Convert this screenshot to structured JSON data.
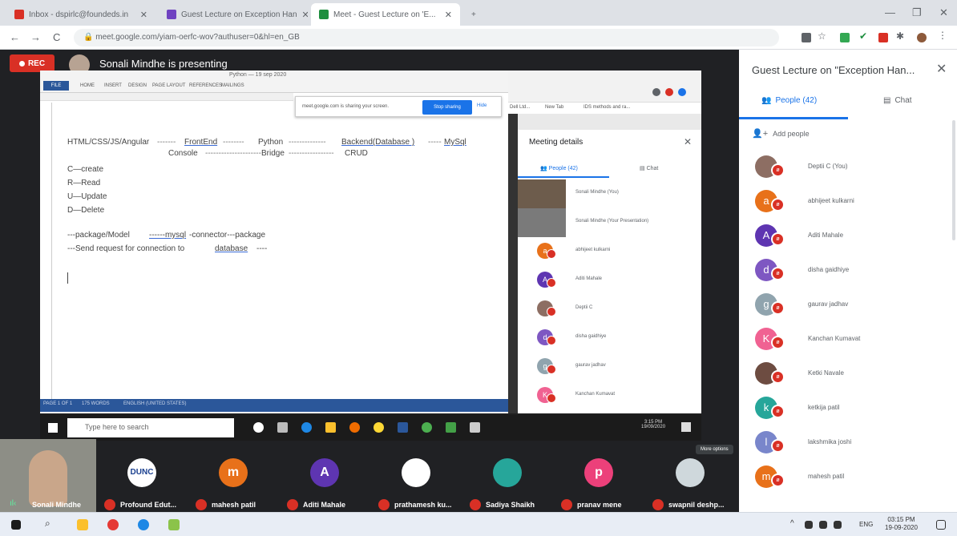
{
  "browser": {
    "tabs": [
      {
        "label": "Inbox - dspirlc@foundeds.in",
        "color": "#d93025",
        "active": false
      },
      {
        "label": "Guest Lecture on Exception Han",
        "color": "#6f42c1",
        "active": false
      },
      {
        "label": "Meet - Guest Lecture on 'E...",
        "color": "#1e8e3e",
        "active": true
      }
    ],
    "new_tab": "+",
    "minimize": "—",
    "maximize": "❐",
    "close": "✕",
    "url": "meet.google.com/yiam-oerfc-wov?authuser=0&hl=en_GB",
    "back": "←",
    "forward": "→",
    "reload": "C"
  },
  "meet": {
    "rec_label": "REC",
    "presenting_text": "Sonali Mindhe is presenting",
    "tooltip": "More options",
    "accent": "#1a73e8",
    "danger": "#d93025"
  },
  "word": {
    "title": "Python — 19 sep 2020",
    "file_tab": "FILE",
    "ribbon_tabs": [
      "HOME",
      "INSERT",
      "DESIGN",
      "PAGE LAYOUT",
      "REFERENCES",
      "MAILINGS"
    ],
    "lines": {
      "l1a": "HTML/CSS/JS/Angular",
      "l1b": "FrontEnd",
      "l1c": "Python",
      "l1d": "Backend(Database )",
      "l1e": "MySql",
      "l1f": "----",
      "l2a": "Console",
      "l2b": "Bridge",
      "l2c": "CRUD",
      "c": "C—create",
      "r": "R—Read",
      "u": "U—Update",
      "d": "D—Delete",
      "pkg1": "---package/Model",
      "pkg2": "------mysql",
      "pkg3": "-connector---package",
      "send1": "---Send request for connection to",
      "send2": "database",
      "send3": "----"
    },
    "status": [
      "PAGE 1 OF 1",
      "175 WORDS",
      "ENGLISH (UNITED STATES)"
    ]
  },
  "sharing_bar": {
    "text": "meet.google.com is sharing your screen.",
    "stop": "Stop sharing",
    "hide": "Hide"
  },
  "inner_browser": {
    "bookmarks": [
      "Dell Ltd...",
      "New Tab",
      "IDS methods and ra..."
    ]
  },
  "meeting_details": {
    "title": "Meeting details",
    "close": "✕",
    "people_tab": "People (42)",
    "chat_tab": "Chat",
    "rows": [
      {
        "name": "Sonali Mindhe (You)",
        "initial": "",
        "color": "#6d5c4c",
        "tile": true
      },
      {
        "name": "Sonali Mindhe (Your Presentation)",
        "initial": "",
        "color": "#7a7a7a",
        "tile": true
      },
      {
        "name": "abhijeet kulkarni",
        "initial": "a",
        "color": "#e8711a"
      },
      {
        "name": "Aditi Mahale",
        "initial": "A",
        "color": "#5e35b1"
      },
      {
        "name": "Deptii C",
        "initial": "",
        "color": "#8d6e63"
      },
      {
        "name": "disha gaidhiye",
        "initial": "d",
        "color": "#7e57c2"
      },
      {
        "name": "gaurav jadhav",
        "initial": "g",
        "color": "#90a4ae"
      },
      {
        "name": "Kanchan Kumavat",
        "initial": "K",
        "color": "#f06292"
      }
    ]
  },
  "inner_taskbar": {
    "search_placeholder": "Type here to search",
    "clock_time": "3:15 PM",
    "clock_date": "19/09/2020"
  },
  "filmstrip": [
    {
      "name": "Sonali Mindhe",
      "self": true
    },
    {
      "name": "Profound Edut...",
      "initial": "DUNC",
      "color": "#ffffff",
      "text_color": "#1a3f8f"
    },
    {
      "name": "mahesh patil",
      "initial": "m",
      "color": "#e8711a"
    },
    {
      "name": "Aditi Mahale",
      "initial": "A",
      "color": "#5e35b1"
    },
    {
      "name": "prathamesh ku...",
      "initial": "",
      "color": "#ffffff",
      "photo": true
    },
    {
      "name": "Sadiya Shaikh",
      "initial": "",
      "color": "#26a69a"
    },
    {
      "name": "pranav mene",
      "initial": "p",
      "color": "#ec407a"
    },
    {
      "name": "swapnil deshp...",
      "initial": "",
      "color": "#cfd8dc",
      "photo": true
    }
  ],
  "panel": {
    "title": "Guest Lecture on \"Exception Han...",
    "close": "✕",
    "people_tab": "People (42)",
    "chat_tab": "Chat",
    "add_people": "Add people",
    "people": [
      {
        "name": "Deptii C (You)",
        "initial": "",
        "color": "#8d6e63",
        "photo": true
      },
      {
        "name": "abhijeet kulkarni",
        "initial": "a",
        "color": "#e8711a"
      },
      {
        "name": "Aditi Mahale",
        "initial": "A",
        "color": "#5e35b1"
      },
      {
        "name": "disha gaidhiye",
        "initial": "d",
        "color": "#7e57c2"
      },
      {
        "name": "gaurav jadhav",
        "initial": "g",
        "color": "#90a4ae"
      },
      {
        "name": "Kanchan Kumavat",
        "initial": "K",
        "color": "#f06292"
      },
      {
        "name": "Ketki Navale",
        "initial": "",
        "color": "#6d4c41",
        "photo": true
      },
      {
        "name": "ketkija patil",
        "initial": "k",
        "color": "#26a69a"
      },
      {
        "name": "lakshmika joshi",
        "initial": "l",
        "color": "#7986cb"
      },
      {
        "name": "mahesh patil",
        "initial": "m",
        "color": "#e8711a"
      }
    ]
  },
  "win_taskbar": {
    "lang": "ENG",
    "time": "03:15 PM",
    "date": "19-09-2020"
  }
}
